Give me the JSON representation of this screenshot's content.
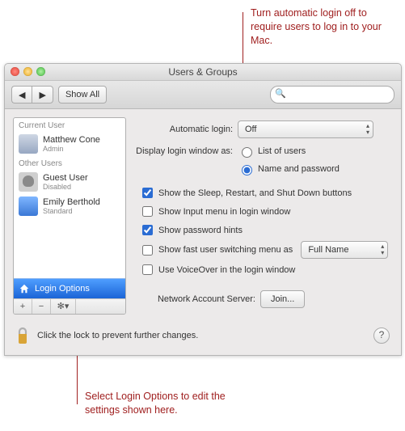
{
  "annotations": {
    "top": "Turn automatic login off to require users to log in to your Mac.",
    "bottom": "Select Login Options to edit the settings shown here."
  },
  "window": {
    "title": "Users & Groups"
  },
  "toolbar": {
    "back": "◀",
    "forward": "▶",
    "show_all": "Show All",
    "search_placeholder": ""
  },
  "sidebar": {
    "current_label": "Current User",
    "current": {
      "name": "Matthew Cone",
      "role": "Admin"
    },
    "other_label": "Other Users",
    "others": [
      {
        "name": "Guest User",
        "role": "Disabled"
      },
      {
        "name": "Emily Berthold",
        "role": "Standard"
      }
    ],
    "login_options": "Login Options",
    "footer": {
      "add": "+",
      "remove": "−",
      "gear": "✻▾"
    }
  },
  "panel": {
    "auto_login_label": "Automatic login:",
    "auto_login_value": "Off",
    "display_label": "Display login window as:",
    "radio_list": "List of users",
    "radio_namepw": "Name and password",
    "radio_selected": "namepw",
    "chk_sleep": "Show the Sleep, Restart, and Shut Down buttons",
    "chk_input": "Show Input menu in login window",
    "chk_hints": "Show password hints",
    "chk_fast": "Show fast user switching menu as",
    "fast_value": "Full Name",
    "chk_voiceover": "Use VoiceOver in the login window",
    "checked": {
      "sleep": true,
      "input": false,
      "hints": true,
      "fast": false,
      "voiceover": false
    },
    "net_label": "Network Account Server:",
    "join": "Join..."
  },
  "lock": {
    "text": "Click the lock to prevent further changes.",
    "help": "?"
  }
}
